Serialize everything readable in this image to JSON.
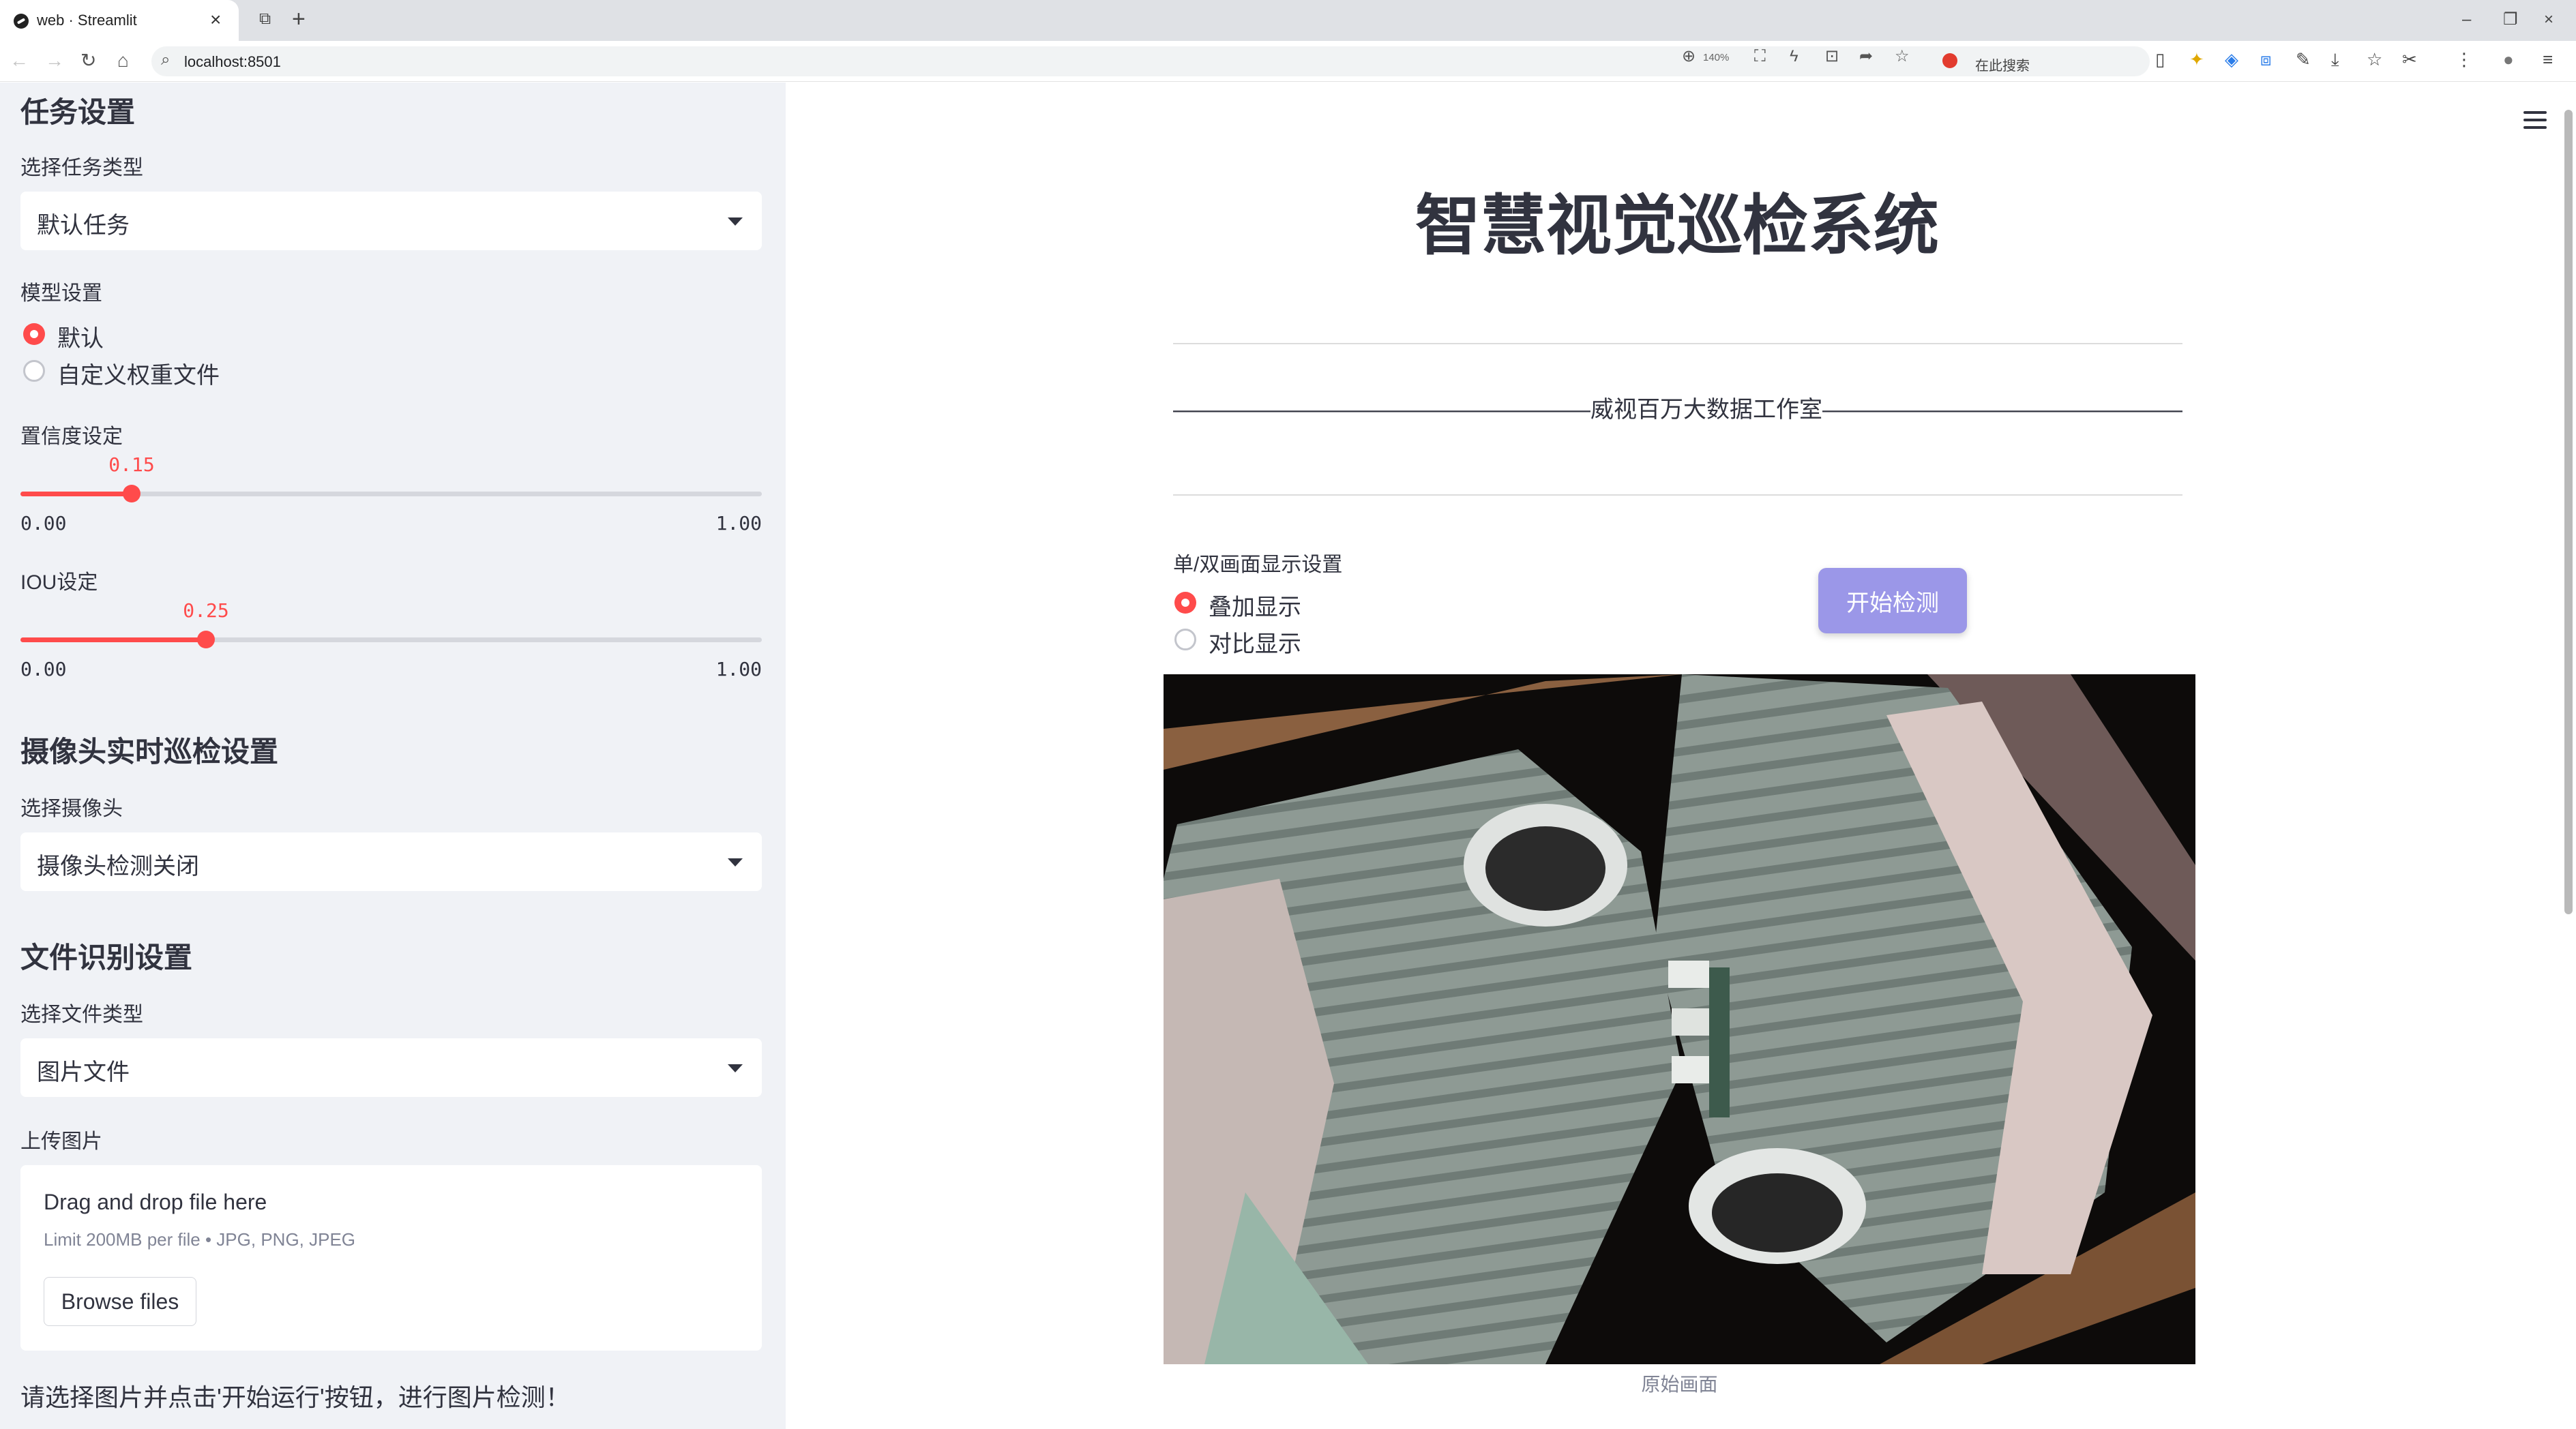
{
  "browser": {
    "tab_title": "web · Streamlit",
    "url": "localhost:8501",
    "zoom": "140%",
    "search_label": "在此搜索"
  },
  "sidebar": {
    "task_section_title": "任务设置",
    "task_type_label": "选择任务类型",
    "task_type_value": "默认任务",
    "model_label": "模型设置",
    "model_options": [
      "默认",
      "自定义权重文件"
    ],
    "model_selected": 0,
    "confidence": {
      "label": "置信度设定",
      "value": "0.15",
      "value_num": 0.15,
      "min": "0.00",
      "max": "1.00"
    },
    "iou": {
      "label": "IOU设定",
      "value": "0.25",
      "value_num": 0.25,
      "min": "0.00",
      "max": "1.00"
    },
    "camera_section_title": "摄像头实时巡检设置",
    "camera_label": "选择摄像头",
    "camera_value": "摄像头检测关闭",
    "file_section_title": "文件识别设置",
    "file_type_label": "选择文件类型",
    "file_type_value": "图片文件",
    "upload_label": "上传图片",
    "uploader": {
      "title": "Drag and drop file here",
      "limit": "Limit 200MB per file • JPG, PNG, JPEG",
      "browse_label": "Browse files"
    },
    "hint": "请选择图片并点击'开始运行'按钮，进行图片检测！"
  },
  "main": {
    "title": "智慧视觉巡检系统",
    "subtitle": "——————————————————威视百万大数据工作室——————————————————",
    "display_mode_label": "单/双画面显示设置",
    "display_options": [
      "叠加显示",
      "对比显示"
    ],
    "display_selected": 0,
    "start_button": "开始检测",
    "image_caption": "原始画面"
  },
  "colors": {
    "accent": "#ff4b4b",
    "sidebar_bg": "#f0f2f6",
    "button": "#9b97e8"
  }
}
